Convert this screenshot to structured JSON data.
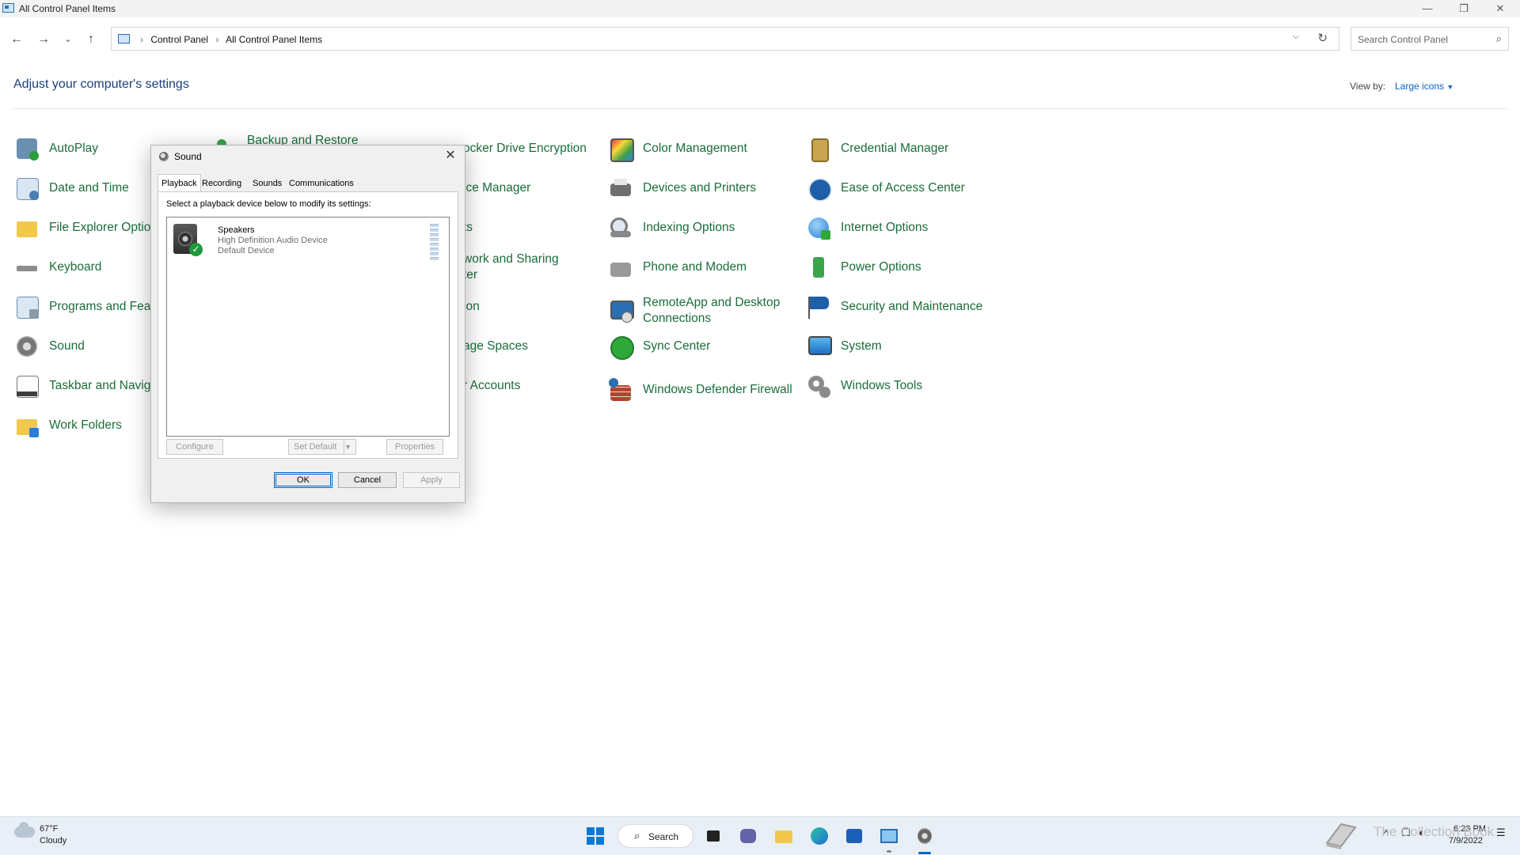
{
  "window": {
    "title": "All Control Panel Items",
    "controls": {
      "minimize": "—",
      "restore": "❐",
      "close": "✕"
    }
  },
  "address": {
    "breadcrumb": [
      "Control Panel",
      "All Control Panel Items"
    ],
    "search_placeholder": "Search Control Panel"
  },
  "header": {
    "title": "Adjust your computer's settings",
    "view_by_label": "View by:",
    "view_by_value": "Large icons"
  },
  "items": [
    {
      "label": "AutoPlay",
      "icon": "autoplay-icon"
    },
    {
      "label": "Date and Time",
      "icon": "clock-calendar-icon"
    },
    {
      "label": "File Explorer Optio",
      "icon": "folder-icon"
    },
    {
      "label": "Keyboard",
      "icon": "keyboard-icon"
    },
    {
      "label": "Programs and Feat",
      "icon": "programs-icon"
    },
    {
      "label": "Sound",
      "icon": "speaker-icon"
    },
    {
      "label": "Taskbar and Navig",
      "icon": "taskbar-icon"
    },
    {
      "label": "Work Folders",
      "icon": "work-folders-icon"
    },
    {
      "label": "Backup and Restore",
      "icon": "backup-icon"
    },
    {
      "label": "ocker Drive Encryption",
      "icon": "bitlocker-icon"
    },
    {
      "label": "ice Manager",
      "icon": "device-manager-icon"
    },
    {
      "label": "ts",
      "icon": "fonts-icon"
    },
    {
      "label": "work and Sharing\nter",
      "icon": "network-icon"
    },
    {
      "label": "ion",
      "icon": "recovery-icon"
    },
    {
      "label": "age Spaces",
      "icon": "storage-icon"
    },
    {
      "label": "r Accounts",
      "icon": "user-accounts-icon"
    },
    {
      "label": "Color Management",
      "icon": "color-management-icon"
    },
    {
      "label": "Devices and Printers",
      "icon": "printer-icon"
    },
    {
      "label": "Indexing Options",
      "icon": "indexing-icon"
    },
    {
      "label": "Phone and Modem",
      "icon": "phone-icon"
    },
    {
      "label": "RemoteApp and Desktop Connections",
      "icon": "remote-desktop-icon"
    },
    {
      "label": "Sync Center",
      "icon": "sync-icon"
    },
    {
      "label": "Windows Defender Firewall",
      "icon": "firewall-icon"
    },
    {
      "label": "Credential Manager",
      "icon": "credential-icon"
    },
    {
      "label": "Ease of Access Center",
      "icon": "accessibility-icon"
    },
    {
      "label": "Internet Options",
      "icon": "globe-icon"
    },
    {
      "label": "Power Options",
      "icon": "power-icon"
    },
    {
      "label": "Security and Maintenance",
      "icon": "flag-icon"
    },
    {
      "label": "System",
      "icon": "monitor-icon"
    },
    {
      "label": "Windows Tools",
      "icon": "gears-icon"
    }
  ],
  "dialog": {
    "title": "Sound",
    "close": "✕",
    "tabs": [
      "Playback",
      "Recording",
      "Sounds",
      "Communications"
    ],
    "active_tab": "Playback",
    "instruction": "Select a playback device below to modify its settings:",
    "device": {
      "name": "Speakers",
      "description": "High Definition Audio Device",
      "status": "Default Device"
    },
    "buttons": {
      "configure": "Configure",
      "set_default": "Set Default",
      "properties": "Properties",
      "ok": "OK",
      "cancel": "Cancel",
      "apply": "Apply"
    }
  },
  "taskbar": {
    "weather_temp": "67°F",
    "weather_cond": "Cloudy",
    "search": "Search",
    "watermark": "The Collection Book",
    "time": "6:23 PM",
    "date": "7/9/2022"
  },
  "colors": {
    "link_green": "#1a6d3a",
    "title_blue": "#1a3f7a",
    "accent": "#0a64c8"
  }
}
